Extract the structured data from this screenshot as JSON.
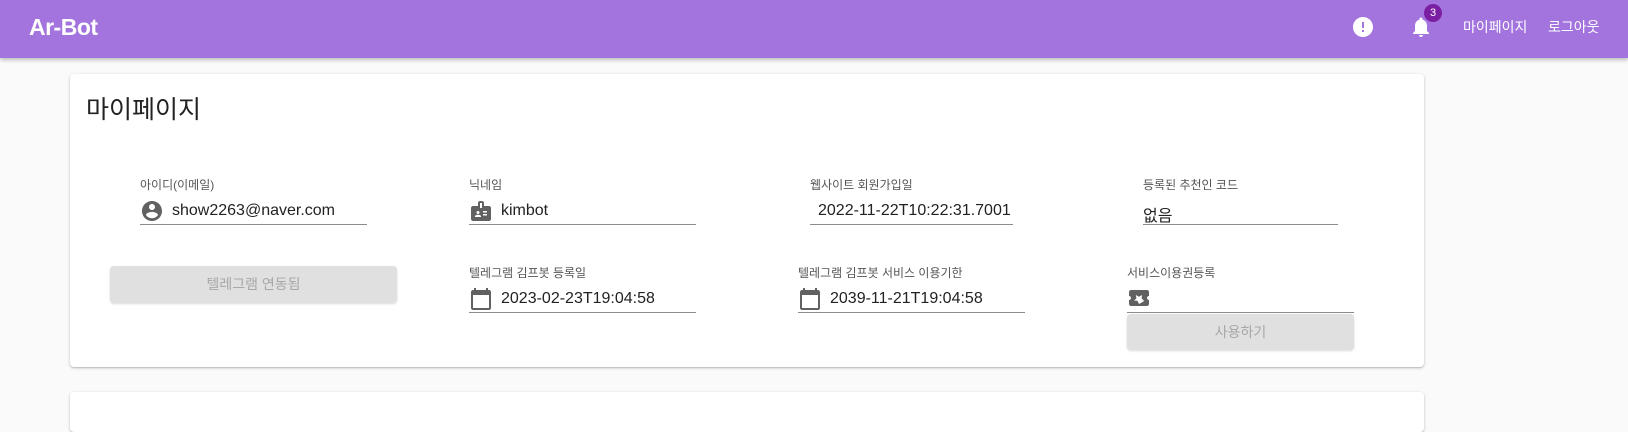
{
  "app": {
    "title": "Ar-Bot",
    "notification_count": "3"
  },
  "nav": {
    "mypage": "마이페이지",
    "logout": "로그아웃"
  },
  "page": {
    "title": "마이페이지"
  },
  "fields": {
    "email": {
      "label": "아이디(이메일)",
      "value": "show2263@naver.com",
      "icon": "account-circle-icon"
    },
    "nickname": {
      "label": "닉네임",
      "value": "kimbot",
      "icon": "badge-icon"
    },
    "signup_date": {
      "label": "웹사이트 회원가입일",
      "value": "2022-11-22T10:22:31.7001"
    },
    "referral_code": {
      "label": "등록된 추천인 코드",
      "value": "없음"
    },
    "telegram_registered": {
      "label": "텔레그램 김프봇 등록일",
      "value": "2023-02-23T19:04:58",
      "icon": "calendar-icon"
    },
    "telegram_expiry": {
      "label": "텔레그램 김프봇 서비스 이용기한",
      "value": "2039-11-21T19:04:58",
      "icon": "calendar-icon"
    },
    "voucher": {
      "label": "서비스이용권등록",
      "value": "",
      "icon": "ticket-star-icon"
    }
  },
  "buttons": {
    "telegram_linked": "텔레그램 연동됨",
    "use": "사용하기"
  },
  "colors": {
    "appbar": "#a374dd",
    "badge": "#7b1fa2"
  }
}
